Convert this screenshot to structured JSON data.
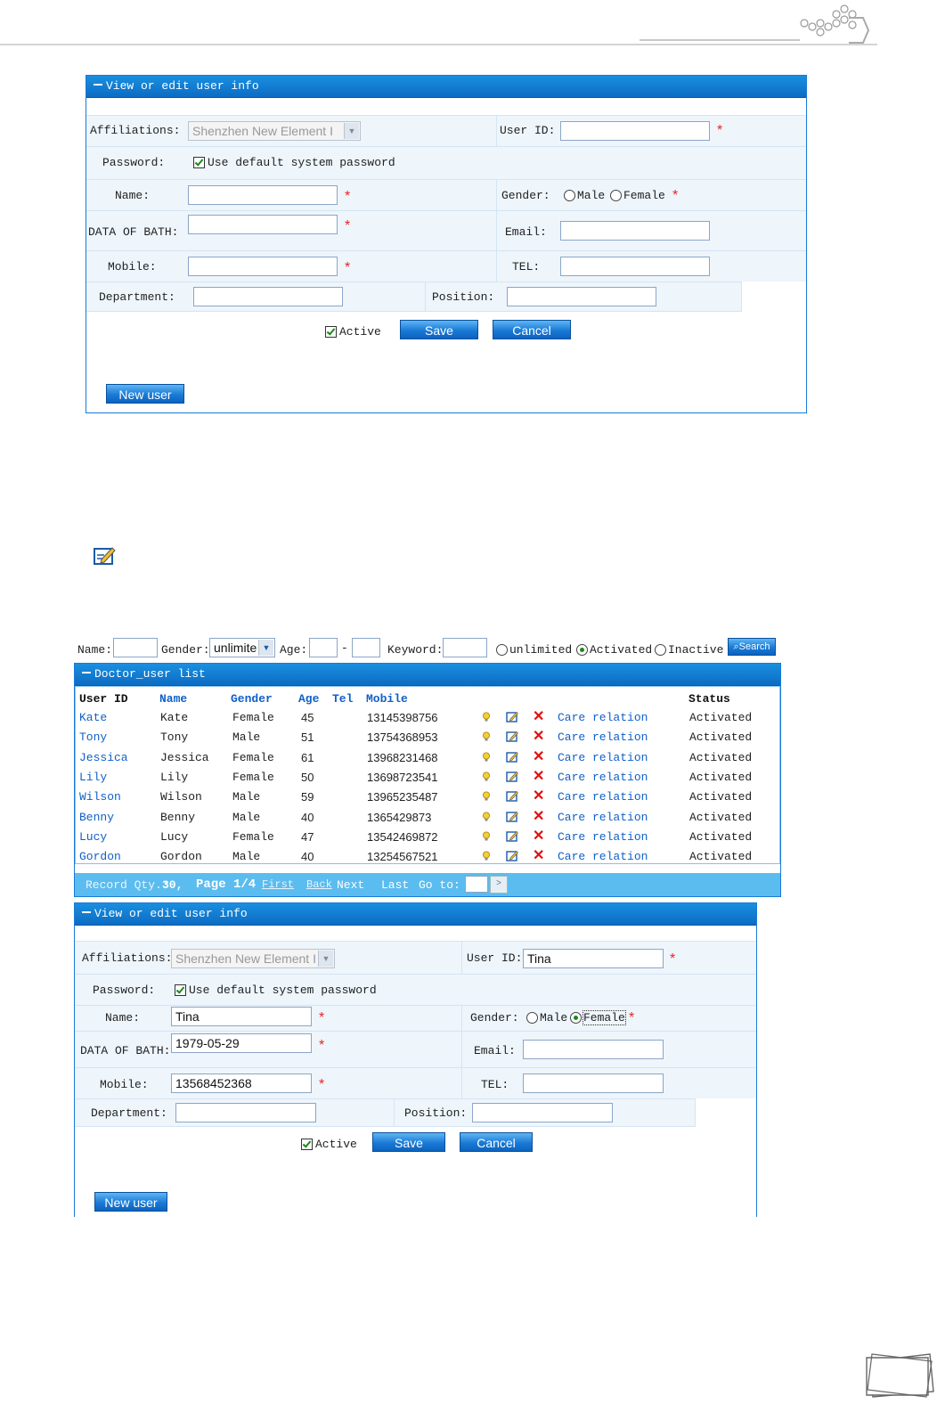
{
  "form1": {
    "title": "View or edit user info",
    "affiliations_label": "Affiliations:",
    "affiliations_value": "Shenzhen New Element I",
    "user_id_label": "User ID:",
    "user_id_value": "",
    "password_label": "Password:",
    "password_option": "Use default system password",
    "name_label": "Name:",
    "name_value": "",
    "gender_label": "Gender:",
    "male": "Male",
    "female": "Female",
    "dob_label": "DATA OF BATH:",
    "dob_value": "",
    "email_label": "Email:",
    "mobile_label": "Mobile:",
    "mobile_value": "",
    "tel_label": "TEL:",
    "department_label": "Department:",
    "position_label": "Position:",
    "active_label": "Active",
    "save": "Save",
    "cancel": "Cancel",
    "new_user": "New user",
    "required_mark": "*"
  },
  "search": {
    "name_label": "Name:",
    "gender_label": "Gender:",
    "gender_value": "unlimite",
    "age_label": "Age:",
    "age_sep": "-",
    "keyword_label": "Keyword:",
    "opt_unlimited": "unlimited",
    "opt_activated": "Activated",
    "opt_inactive": "Inactive",
    "search_button": "Search"
  },
  "list": {
    "title": "Doctor_user list",
    "headers": [
      "User ID",
      "Name",
      "Gender",
      "Age",
      "Tel",
      "Mobile",
      "Status"
    ],
    "rows": [
      {
        "id": "Kate",
        "name": "Kate",
        "gender": "Female",
        "age": "45",
        "mobile": "13145398756",
        "relation": "Care relation",
        "status": "Activated"
      },
      {
        "id": "Tony",
        "name": "Tony",
        "gender": "Male",
        "age": "51",
        "mobile": "13754368953",
        "relation": "Care relation",
        "status": "Activated"
      },
      {
        "id": "Jessica",
        "name": "Jessica",
        "gender": "Female",
        "age": "61",
        "mobile": "13968231468",
        "relation": "Care relation",
        "status": "Activated"
      },
      {
        "id": "Lily",
        "name": "Lily",
        "gender": "Female",
        "age": "50",
        "mobile": "13698723541",
        "relation": "Care relation",
        "status": "Activated"
      },
      {
        "id": "Wilson",
        "name": "Wilson",
        "gender": "Male",
        "age": "59",
        "mobile": "13965235487",
        "relation": "Care relation",
        "status": "Activated"
      },
      {
        "id": "Benny",
        "name": "Benny",
        "gender": "Male",
        "age": "40",
        "mobile": "1365429873",
        "relation": "Care relation",
        "status": "Activated"
      },
      {
        "id": "Lucy",
        "name": "Lucy",
        "gender": "Female",
        "age": "47",
        "mobile": "13542469872",
        "relation": "Care relation",
        "status": "Activated"
      },
      {
        "id": "Gordon",
        "name": "Gordon",
        "gender": "Male",
        "age": "40",
        "mobile": "13254567521",
        "relation": "Care relation",
        "status": "Activated"
      }
    ],
    "footer": {
      "record_label": "Record Qty.:",
      "record_value": "30,",
      "page_label": "Page 1/4",
      "first": "First",
      "back": "Back",
      "next": "Next",
      "last": "Last",
      "goto": "Go to:",
      "go_btn": ">"
    }
  },
  "form2": {
    "title": "View or edit user info",
    "affiliations_label": "Affiliations:",
    "affiliations_value": "Shenzhen New Element I",
    "user_id_label": "User ID:",
    "user_id_value": "Tina",
    "password_label": "Password:",
    "password_option": "Use default system password",
    "name_label": "Name:",
    "name_value": "Tina",
    "gender_label": "Gender:",
    "male": "Male",
    "female": "Female",
    "dob_label": "DATA OF BATH:",
    "dob_value": "1979-05-29",
    "email_label": "Email:",
    "mobile_label": "Mobile:",
    "mobile_value": "13568452368",
    "tel_label": "TEL:",
    "department_label": "Department:",
    "position_label": "Position:",
    "active_label": "Active",
    "save": "Save",
    "cancel": "Cancel",
    "new_user": "New user",
    "required_mark": "*"
  },
  "colors": {
    "title_bar": "#0c6cc4",
    "row_bg": "#eef5fb",
    "link": "#1060c8",
    "required": "#e22222"
  }
}
